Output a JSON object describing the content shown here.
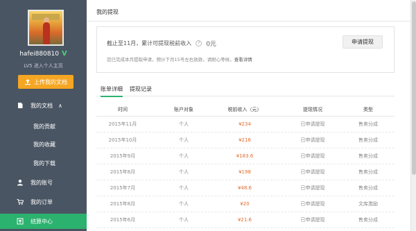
{
  "sidebar": {
    "username": "hafei880810",
    "verified_mark": "V",
    "level": "LV5",
    "home_link": "进入个人主页",
    "upload_label": "上传我的文档",
    "nav": {
      "my_docs": "我的文档",
      "contributions": "我的贡献",
      "favorites": "我的收藏",
      "downloads": "我的下载",
      "account": "我的账号",
      "orders": "我的订单",
      "settlement": "结算中心"
    },
    "chevron": "∧"
  },
  "main": {
    "title": "我的提现",
    "summary": {
      "prefix": "截止至11月，累计可提现税前收入",
      "help": "?",
      "amount": "0元",
      "note": "您已完成本月提取申请，预计下月15号左右放款，请耐心等候，",
      "detail_link": "查看详情",
      "apply_button": "申请提现"
    },
    "tabs": [
      "账单详细",
      "提现记录"
    ],
    "table": {
      "headers": [
        "时间",
        "账户对象",
        "税前收入（元）",
        "提现情况",
        "类型"
      ],
      "rows": [
        [
          "2015年11月",
          "个人",
          "¥234",
          "已申请提现",
          "售卖分成"
        ],
        [
          "2015年10月",
          "个人",
          "¥216",
          "已申请提现",
          "售卖分成"
        ],
        [
          "2015年9月",
          "个人",
          "¥183.6",
          "已申请提现",
          "售卖分成"
        ],
        [
          "2015年8月",
          "个人",
          "¥198",
          "已申请提现",
          "售卖分成"
        ],
        [
          "2015年7月",
          "个人",
          "¥48.6",
          "已申请提现",
          "售卖分成"
        ],
        [
          "2015年8月",
          "个人",
          "¥20",
          "已申请提现",
          "文库激励"
        ],
        [
          "2015年6月",
          "个人",
          "¥21.6",
          "已申请提现",
          "售卖分成"
        ]
      ]
    }
  },
  "colors": {
    "sidebar_bg": "#4a5563",
    "accent_green": "#2bb26e",
    "upload_orange": "#f5a623",
    "money_orange": "#e06a2b"
  }
}
